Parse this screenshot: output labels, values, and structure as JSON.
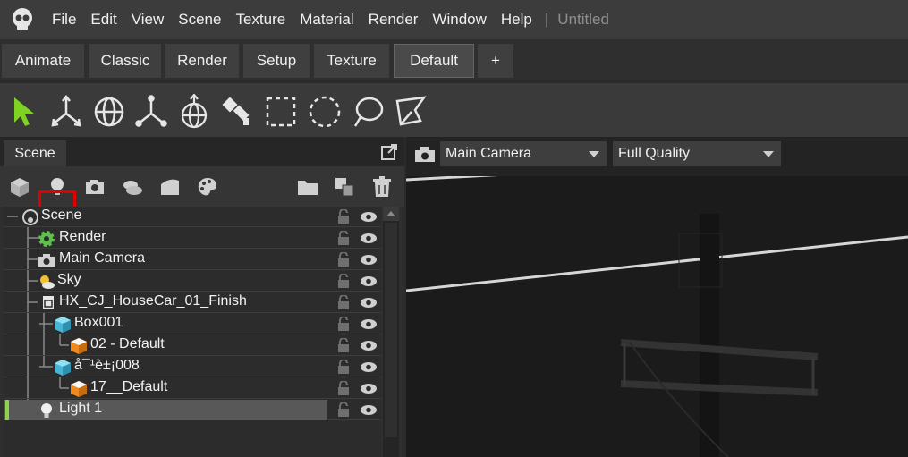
{
  "menubar": {
    "items": [
      "File",
      "Edit",
      "View",
      "Scene",
      "Texture",
      "Material",
      "Render",
      "Window",
      "Help"
    ],
    "separator": "|",
    "document_title": "Untitled"
  },
  "layout_tabs": [
    "Animate",
    "Classic",
    "Render",
    "Setup",
    "Texture",
    "Default",
    "+"
  ],
  "active_layout_tab": "Default",
  "toolbar": {
    "tools": [
      "select-arrow-icon",
      "move-axes-icon",
      "rotate-globe-icon",
      "scale-axes-icon",
      "transform-gizmo-icon",
      "paint-brush-icon",
      "rect-select-icon",
      "circle-select-icon",
      "lasso-select-icon",
      "polygon-select-icon"
    ],
    "accent_color": "#7ed321"
  },
  "scene_panel": {
    "tab_label": "Scene",
    "filter_icons": [
      "cube-icon",
      "light-bulb-icon",
      "camera-icon",
      "sky-icon",
      "material-icon",
      "palette-icon"
    ],
    "action_icons": [
      "folder-icon",
      "group-icon",
      "trash-icon"
    ],
    "highlight_color": "#e00000",
    "tree": [
      {
        "label": "Scene",
        "icon": "scene-icon",
        "depth": 0
      },
      {
        "label": "Render",
        "icon": "render-gear-icon",
        "depth": 1
      },
      {
        "label": "Main Camera",
        "icon": "camera-icon",
        "depth": 1
      },
      {
        "label": "Sky",
        "icon": "sky-icon",
        "depth": 1
      },
      {
        "label": "HX_CJ_HouseCar_01_Finish",
        "icon": "group-icon",
        "depth": 1
      },
      {
        "label": "Box001",
        "icon": "mesh-cube-icon",
        "depth": 2
      },
      {
        "label": "02 - Default",
        "icon": "material-cube-icon",
        "depth": 3
      },
      {
        "label": "å¯¹è±¡008",
        "icon": "mesh-cube-icon",
        "depth": 2
      },
      {
        "label": "17__Default",
        "icon": "material-cube-icon",
        "depth": 3
      },
      {
        "label": "Light 1",
        "icon": "light-bulb-icon",
        "depth": 1,
        "selected": true
      }
    ]
  },
  "viewport": {
    "camera_select": "Main Camera",
    "quality_select": "Full Quality"
  }
}
